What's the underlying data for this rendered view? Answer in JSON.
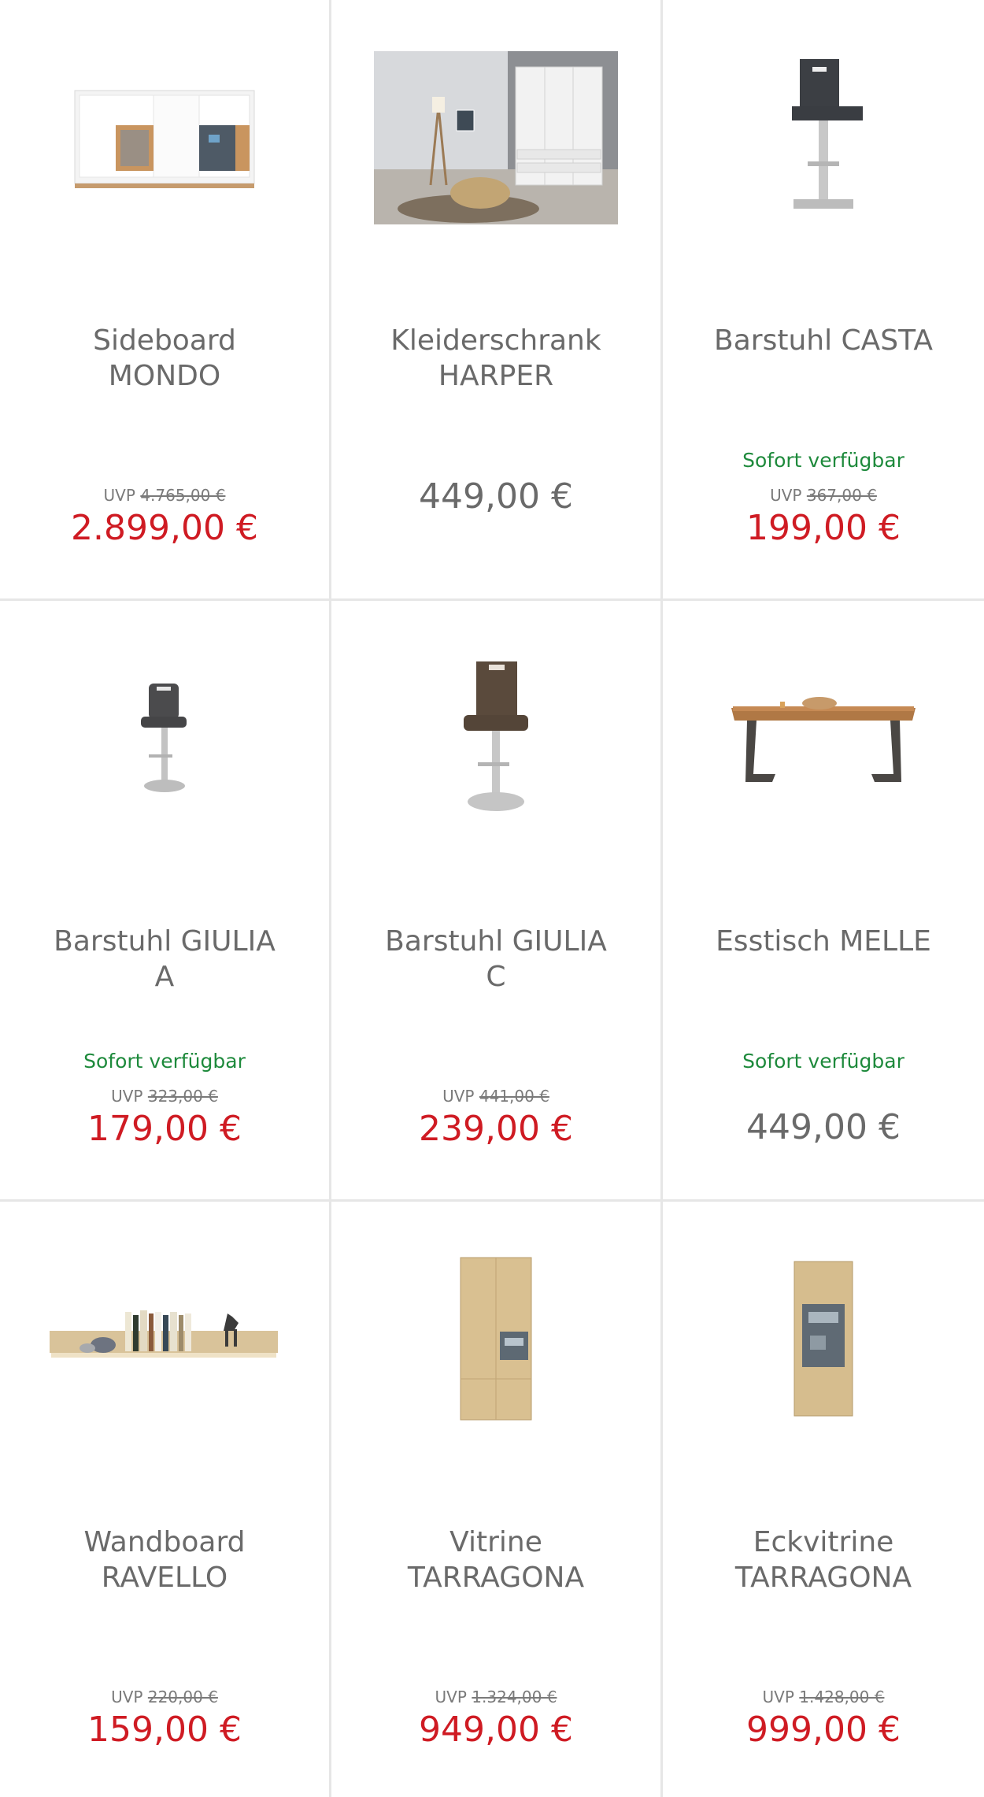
{
  "products": [
    {
      "title_line1": "Sideboard",
      "title_line2": "MONDO",
      "availability": "",
      "uvp_label": "UVP",
      "uvp_price": "4.765,00 €",
      "price": "2.899,00 €",
      "image": "sideboard-image"
    },
    {
      "title_line1": "Kleiderschrank",
      "title_line2": "HARPER",
      "availability": "",
      "uvp_label": "",
      "uvp_price": "",
      "price": "449,00 €",
      "image": "wardrobe-room-image"
    },
    {
      "title_line1": "Barstuhl CASTA",
      "title_line2": "",
      "availability": "Sofort verfügbar",
      "uvp_label": "UVP",
      "uvp_price": "367,00 €",
      "price": "199,00 €",
      "image": "bar-stool-image"
    },
    {
      "title_line1": "Barstuhl GIULIA",
      "title_line2": "A",
      "availability": "Sofort verfügbar",
      "uvp_label": "UVP",
      "uvp_price": "323,00 €",
      "price": "179,00 €",
      "image": "bar-stool-image"
    },
    {
      "title_line1": "Barstuhl GIULIA",
      "title_line2": "C",
      "availability": "",
      "uvp_label": "UVP",
      "uvp_price": "441,00 €",
      "price": "239,00 €",
      "image": "bar-stool-image"
    },
    {
      "title_line1": "Esstisch MELLE",
      "title_line2": "",
      "availability": "Sofort verfügbar",
      "uvp_label": "",
      "uvp_price": "",
      "price": "449,00 €",
      "image": "dining-table-image"
    },
    {
      "title_line1": "Wandboard",
      "title_line2": "RAVELLO",
      "availability": "",
      "uvp_label": "UVP",
      "uvp_price": "220,00 €",
      "price": "159,00 €",
      "image": "wall-shelf-image"
    },
    {
      "title_line1": "Vitrine",
      "title_line2": "TARRAGONA",
      "availability": "",
      "uvp_label": "UVP",
      "uvp_price": "1.324,00 €",
      "price": "949,00 €",
      "image": "display-cabinet-image"
    },
    {
      "title_line1": "Eckvitrine",
      "title_line2": "TARRAGONA",
      "availability": "",
      "uvp_label": "UVP",
      "uvp_price": "1.428,00 €",
      "price": "999,00 €",
      "image": "corner-display-cabinet-image"
    }
  ],
  "colors": {
    "sale_price": "#cf1b23",
    "availability": "#1e8a3c",
    "text": "#6a6a6a",
    "divider": "#e6e6e6"
  }
}
